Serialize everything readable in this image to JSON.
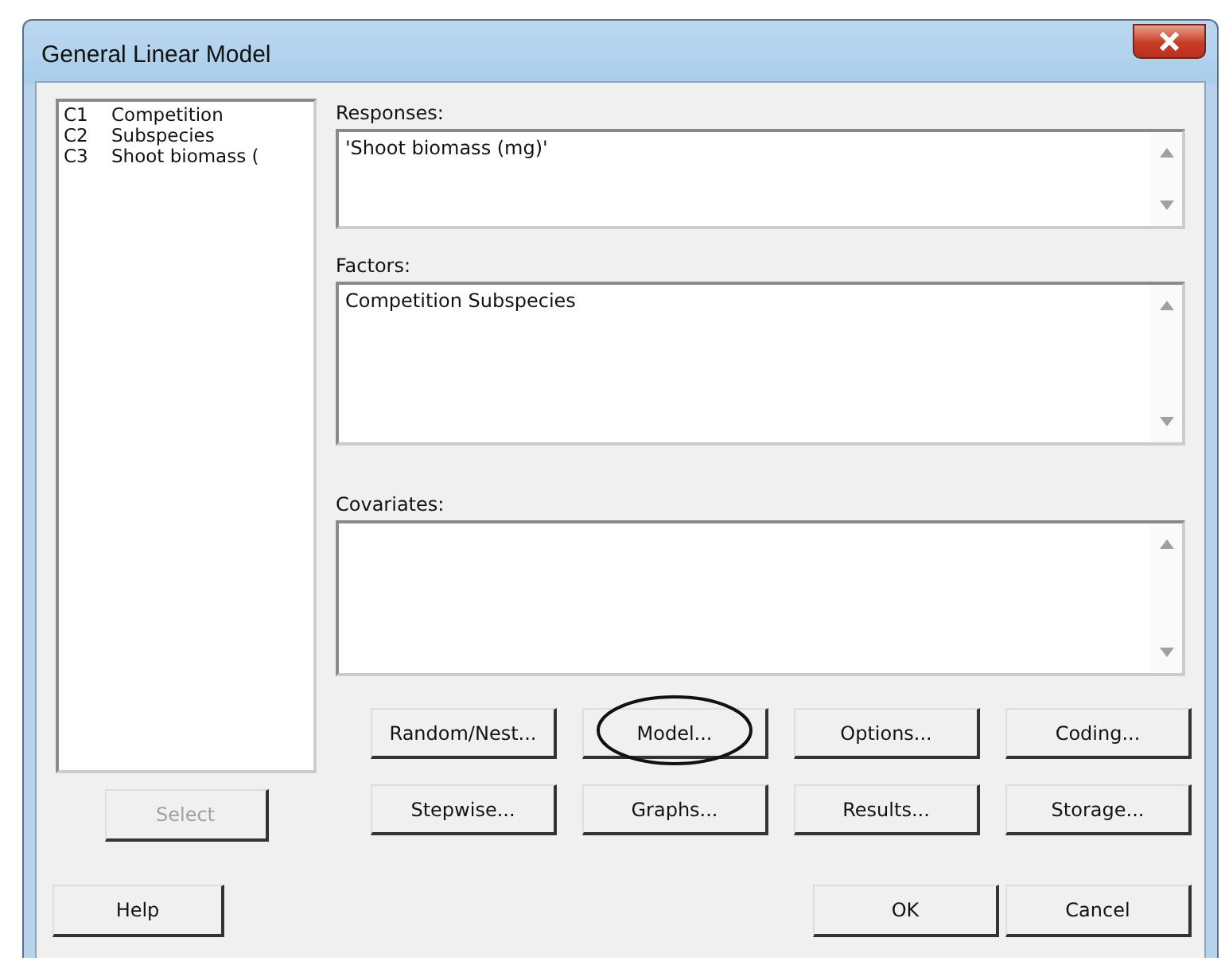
{
  "window": {
    "title": "General Linear Model"
  },
  "columns": [
    {
      "id": "C1",
      "name": "Competition"
    },
    {
      "id": "C2",
      "name": "Subspecies"
    },
    {
      "id": "C3",
      "name": "Shoot biomass ("
    }
  ],
  "fields": [
    {
      "label": "Responses:",
      "value": "'Shoot biomass (mg)'"
    },
    {
      "label": "Factors:",
      "value": "Competition Subspecies"
    },
    {
      "label": "Covariates:"
    }
  ],
  "option_buttons": [
    {
      "label": "Random/Nest...",
      "circled": false
    },
    {
      "label": "Model...",
      "circled": true
    },
    {
      "label": "Options...",
      "circled": false
    },
    {
      "label": "Coding...",
      "circled": false
    },
    {
      "label": "Stepwise...",
      "circled": false
    },
    {
      "label": "Graphs...",
      "circled": false
    },
    {
      "label": "Results...",
      "circled": false
    },
    {
      "label": "Storage...",
      "circled": false
    }
  ],
  "select_button": {
    "label": "Select",
    "disabled": true
  },
  "help_button": {
    "label": "Help"
  },
  "ok_button": {
    "label": "OK"
  },
  "cancel_button": {
    "label": "Cancel"
  }
}
